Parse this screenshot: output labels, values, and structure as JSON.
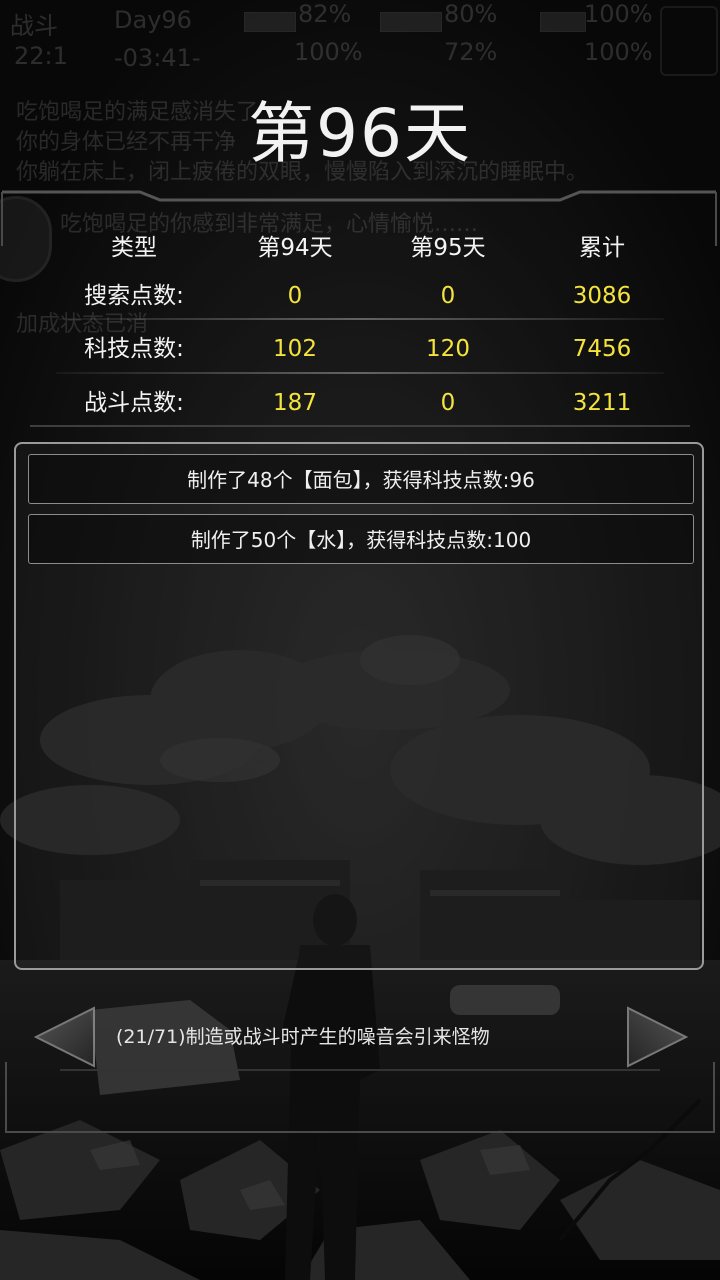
{
  "background": {
    "ghost_stats": [
      "战斗",
      "Day96",
      "82%",
      "80%",
      "100%",
      "22:1",
      "-03:41-",
      "100%",
      "72%",
      "100%"
    ],
    "ghost_lines": [
      "吃饱喝足的满足感消失了",
      "你的身体已经不再干净",
      "你躺在床上，闭上疲倦的双眼，慢慢陷入到深沉的睡眠中。",
      "吃饱喝足的你感到非常满足，心情愉悦……",
      "加成状态已消"
    ]
  },
  "title": "第96天",
  "stats": {
    "headers": [
      "类型",
      "第94天",
      "第95天",
      "累计"
    ],
    "rows": [
      {
        "label": "搜索点数:",
        "day94": "0",
        "day95": "0",
        "total": "3086"
      },
      {
        "label": "科技点数:",
        "day94": "102",
        "day95": "120",
        "total": "7456"
      },
      {
        "label": "战斗点数:",
        "day94": "187",
        "day95": "0",
        "total": "3211"
      }
    ]
  },
  "log": [
    "制作了48个【面包】，获得科技点数:96",
    "制作了50个【水】，获得科技点数:100"
  ],
  "tip": {
    "text": "(21/71)制造或战斗时产生的噪音会引来怪物"
  },
  "colors": {
    "value_yellow": "#f4e33c",
    "panel_border": "#9a9a9a"
  },
  "icons": {
    "prev": "triangle-left-icon",
    "next": "triangle-right-icon"
  }
}
